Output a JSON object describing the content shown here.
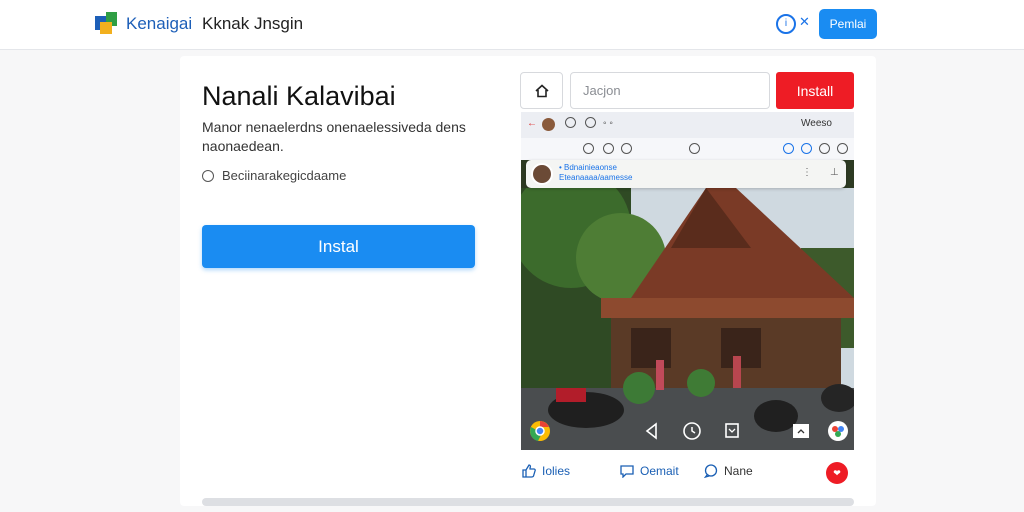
{
  "header": {
    "brand": "Kenaigai",
    "title": "Kknak Jnsgin",
    "button_label": "Pemlai",
    "info_icon": "info-circle-icon",
    "close_icon": "close-icon"
  },
  "hero": {
    "title": "Nanali Kalavibai",
    "description": "Manor nenaelerdns onenaelessiveda dens naonaedean.",
    "check_label": "Beciinarakegicdaame",
    "install_label": "Instal"
  },
  "toolbar": {
    "home_icon": "home-icon",
    "search_placeholder": "Jacjon",
    "install_label": "Install"
  },
  "preview": {
    "bar_text": "Weeso",
    "card_line1": "• Bdnainieaonse",
    "card_line2": "Eteanaaaa/aamesse",
    "scene": "traditional-wooden-house-with-motorbikes"
  },
  "actions": {
    "like": "Iolies",
    "comment": "Oemait",
    "share": "Nane"
  },
  "colors": {
    "accent": "#1a8cf2",
    "danger": "#ee1c25",
    "link": "#1a5fb4"
  }
}
